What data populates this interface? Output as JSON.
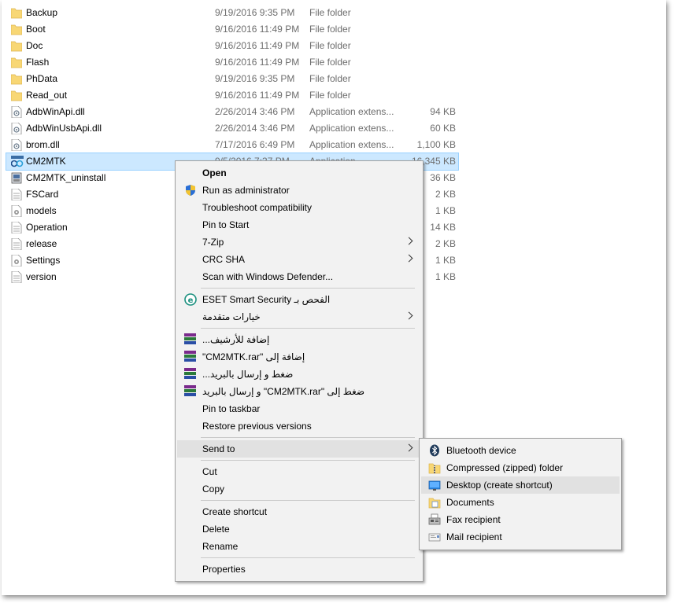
{
  "files": [
    {
      "name": "Backup",
      "date": "9/19/2016 9:35 PM",
      "type": "File folder",
      "size": "",
      "icon": "folder-icon"
    },
    {
      "name": "Boot",
      "date": "9/16/2016 11:49 PM",
      "type": "File folder",
      "size": "",
      "icon": "folder-icon"
    },
    {
      "name": "Doc",
      "date": "9/16/2016 11:49 PM",
      "type": "File folder",
      "size": "",
      "icon": "folder-icon"
    },
    {
      "name": "Flash",
      "date": "9/16/2016 11:49 PM",
      "type": "File folder",
      "size": "",
      "icon": "folder-icon"
    },
    {
      "name": "PhData",
      "date": "9/19/2016 9:35 PM",
      "type": "File folder",
      "size": "",
      "icon": "folder-icon"
    },
    {
      "name": "Read_out",
      "date": "9/16/2016 11:49 PM",
      "type": "File folder",
      "size": "",
      "icon": "folder-icon"
    },
    {
      "name": "AdbWinApi.dll",
      "date": "2/26/2014 3:46 PM",
      "type": "Application extens...",
      "size": "94 KB",
      "icon": "dll-icon"
    },
    {
      "name": "AdbWinUsbApi.dll",
      "date": "2/26/2014 3:46 PM",
      "type": "Application extens...",
      "size": "60 KB",
      "icon": "dll-icon"
    },
    {
      "name": "brom.dll",
      "date": "7/17/2016 6:49 PM",
      "type": "Application extens...",
      "size": "1,100 KB",
      "icon": "dll-icon"
    },
    {
      "name": "CM2MTK",
      "date": "9/5/2016 7:37 PM",
      "type": "Application",
      "size": "16,345 KB",
      "icon": "app-icon"
    },
    {
      "name": "CM2MTK_uninstall",
      "date": "",
      "type": "",
      "size": "36 KB",
      "icon": "uninstall-icon"
    },
    {
      "name": "FSCard",
      "date": "",
      "type": "",
      "size": "2 KB",
      "icon": "file-icon"
    },
    {
      "name": "models",
      "date": "",
      "type": "",
      "size": "1 KB",
      "icon": "settings-file-icon"
    },
    {
      "name": "Operation",
      "date": "",
      "type": "",
      "size": "14 KB",
      "icon": "file-icon"
    },
    {
      "name": "release",
      "date": "",
      "type": "",
      "size": "2 KB",
      "icon": "file-icon"
    },
    {
      "name": "Settings",
      "date": "",
      "type": "",
      "size": "1 KB",
      "icon": "settings-file-icon"
    },
    {
      "name": "version",
      "date": "",
      "type": "",
      "size": "1 KB",
      "icon": "file-icon"
    }
  ],
  "context_menu": {
    "open": "Open",
    "run_as_admin": "Run as administrator",
    "troubleshoot": "Troubleshoot compatibility",
    "pin_start": "Pin to Start",
    "seven_zip": "7-Zip",
    "crc_sha": "CRC SHA",
    "scan_defender": "Scan with Windows Defender...",
    "eset_scan": "الفحص بـ ESET Smart Security",
    "advanced_options": "خيارات متقدمة",
    "add_archive": "إضافة للأرشيف...",
    "add_to_rar": "إضافة إلى \"CM2MTK.rar\"",
    "compress_email": "ضغط و إرسال بالبريد...",
    "compress_rar_email": "ضغط إلى \"CM2MTK.rar\" و إرسال بالبريد",
    "pin_taskbar": "Pin to taskbar",
    "restore_versions": "Restore previous versions",
    "send_to": "Send to",
    "cut": "Cut",
    "copy": "Copy",
    "create_shortcut": "Create shortcut",
    "delete": "Delete",
    "rename": "Rename",
    "properties": "Properties"
  },
  "send_to_menu": {
    "bluetooth": "Bluetooth device",
    "compressed": "Compressed (zipped) folder",
    "desktop": "Desktop (create shortcut)",
    "documents": "Documents",
    "fax": "Fax recipient",
    "mail": "Mail recipient"
  },
  "colors": {
    "selection": "#cce8ff",
    "menu_bg": "#f2f2f2",
    "menu_highlight": "#e1e1e1",
    "folder": "#f8d775"
  }
}
